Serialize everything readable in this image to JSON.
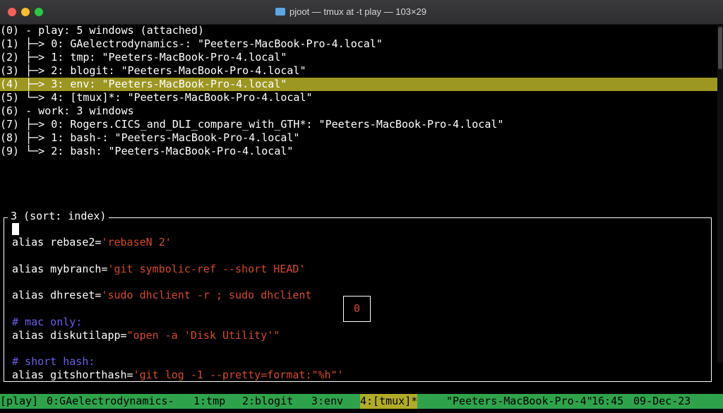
{
  "window": {
    "title": "pjoot — tmux at -t play — 103×29",
    "title_icon": "folder-icon"
  },
  "tree": {
    "lines": [
      "(0) - play: 5 windows (attached)",
      "(1) ├─> 0: GAelectrodynamics-: \"Peeters-MacBook-Pro-4.local\"",
      "(2) ├─> 1: tmp: \"Peeters-MacBook-Pro-4.local\"",
      "(3) ├─> 2: blogit: \"Peeters-MacBook-Pro-4.local\"",
      "(4) ├─> 3: env: \"Peeters-MacBook-Pro-4.local\"",
      "(5) └─> 4: [tmux]*: \"Peeters-MacBook-Pro-4.local\"",
      "(6) - work: 3 windows",
      "(7) ├─> 0: Rogers.CICS_and_DLI_compare_with_GTH*: \"Peeters-MacBook-Pro-4.local\"",
      "(8) ├─> 1: bash-: \"Peeters-MacBook-Pro-4.local\"",
      "(9) └─> 2: bash: \"Peeters-MacBook-Pro-4.local\""
    ],
    "selected_index": 4,
    "selected_color": "#9c9622"
  },
  "preview": {
    "title": "3 (sort: index)",
    "pane_number": "0",
    "lines": [
      {
        "code": "alias rebase2=",
        "str": "'rebaseN 2'"
      },
      {
        "code": "alias mybranch=",
        "str": "'git symbolic-ref --short HEAD'"
      },
      {
        "code": "alias dhreset=",
        "str": "'sudo dhclient -r ; sudo dhclient"
      },
      {
        "comment": "# mac only:"
      },
      {
        "code": "alias diskutilapp=",
        "str": "\"open -a 'Disk Utility'\""
      },
      {
        "comment": "# short hash:"
      },
      {
        "code": "alias gitshorthash=",
        "str": "'git log -1 --pretty=format:\"%h\"'"
      }
    ]
  },
  "statusbar": {
    "session": "[play]",
    "windows": [
      "0:GAelectrodynamics-",
      "1:tmp",
      "2:blogit",
      "3:env",
      "4:[tmux]*"
    ],
    "host": "\"Peeters-MacBook-Pro-4\"",
    "time": "16:45",
    "date": "09-Dec-23",
    "bar_color": "#2fa34b",
    "active_color": "#b1ab2a"
  },
  "colors": {
    "string": "#d24b2a",
    "comment": "#6a5fe8"
  }
}
